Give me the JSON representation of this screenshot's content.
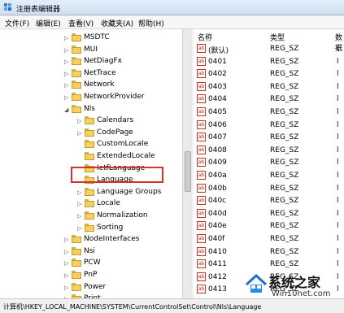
{
  "window": {
    "title": "注册表编辑器"
  },
  "menu": [
    "文件(F)",
    "编辑(E)",
    "查看(V)",
    "收藏夹(A)",
    "帮助(H)"
  ],
  "tree": {
    "items": [
      "MSDTC",
      "MUI",
      "NetDiagFx",
      "NetTrace",
      "Network",
      "NetworkProvider",
      "Nls",
      "Calendars",
      "CodePage",
      "CustomLocale",
      "ExtendedLocale",
      "IetfLanguage",
      "Language",
      "Language Groups",
      "Locale",
      "Normalization",
      "Sorting",
      "NodeInterfaces",
      "Nsi",
      "PCW",
      "PnP",
      "Power",
      "Print"
    ],
    "selected": "Language"
  },
  "list": {
    "headers": {
      "name": "名称",
      "type": "类型",
      "data": "数据"
    },
    "rows": [
      {
        "name": "(默认)",
        "type": "REG_SZ",
        "data": "("
      },
      {
        "name": "0401",
        "type": "REG_SZ",
        "data": "l"
      },
      {
        "name": "0402",
        "type": "REG_SZ",
        "data": "l"
      },
      {
        "name": "0403",
        "type": "REG_SZ",
        "data": "l"
      },
      {
        "name": "0404",
        "type": "REG_SZ",
        "data": "l"
      },
      {
        "name": "0405",
        "type": "REG_SZ",
        "data": "l"
      },
      {
        "name": "0406",
        "type": "REG_SZ",
        "data": "l"
      },
      {
        "name": "0407",
        "type": "REG_SZ",
        "data": "l"
      },
      {
        "name": "0408",
        "type": "REG_SZ",
        "data": "l"
      },
      {
        "name": "0409",
        "type": "REG_SZ",
        "data": "l"
      },
      {
        "name": "040a",
        "type": "REG_SZ",
        "data": "l"
      },
      {
        "name": "040b",
        "type": "REG_SZ",
        "data": "l"
      },
      {
        "name": "040c",
        "type": "REG_SZ",
        "data": "l"
      },
      {
        "name": "040d",
        "type": "REG_SZ",
        "data": "l"
      },
      {
        "name": "040e",
        "type": "REG_SZ",
        "data": "l"
      },
      {
        "name": "040f",
        "type": "REG_SZ",
        "data": "l"
      },
      {
        "name": "0410",
        "type": "REG_SZ",
        "data": "l"
      },
      {
        "name": "0411",
        "type": "REG_SZ",
        "data": "l"
      },
      {
        "name": "0412",
        "type": "REG_SZ",
        "data": "l"
      },
      {
        "name": "0413",
        "type": "REG_SZ",
        "data": "l"
      }
    ]
  },
  "status": {
    "path": "计算机\\HKEY_LOCAL_MACHINE\\SYSTEM\\CurrentControlSet\\Control\\Nls\\Language"
  },
  "watermark": {
    "title": "系统之家",
    "subtitle": "Win10net.com"
  },
  "colors": {
    "highlight_box": "#d2342a",
    "folder": "#f4cf62"
  }
}
